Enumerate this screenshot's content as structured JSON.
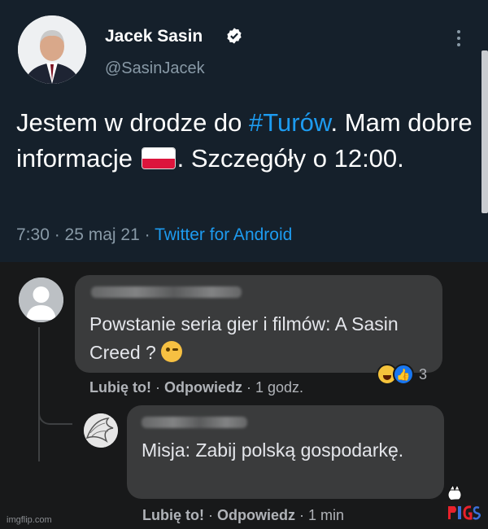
{
  "tweet": {
    "author_name": "Jacek Sasin",
    "handle": "@SasinJacek",
    "text_parts": {
      "before_hashtag": "Jestem w drodze do ",
      "hashtag": "#Turów",
      "after_hashtag": ". Mam dobre informacje ",
      "after_flag": ". Szczegóły o 12:00."
    },
    "time": "7:30",
    "separator1": " · ",
    "date": "25 maj 21",
    "separator2": " · ",
    "source": "Twitter for Android"
  },
  "comments": [
    {
      "text": "Powstanie seria gier i filmów: A Sasin Creed ? ",
      "like_label": "Lubię to!",
      "reply_label": "Odpowiedz",
      "time": "1 godz.",
      "separator": " · ",
      "reactions": [
        "haha",
        "like"
      ],
      "reaction_count": "3"
    },
    {
      "text": "Misja: Zabij polską gospodarkę.",
      "like_label": "Lubię to!",
      "reply_label": "Odpowiedz",
      "time": "1 min",
      "separator": " · "
    }
  ],
  "watermark": "imgflip.com",
  "colors": {
    "twitter_bg": "#15202b",
    "twitter_link": "#1d9bf0",
    "fb_bg": "#18191a",
    "fb_bubble": "#3a3b3c"
  }
}
